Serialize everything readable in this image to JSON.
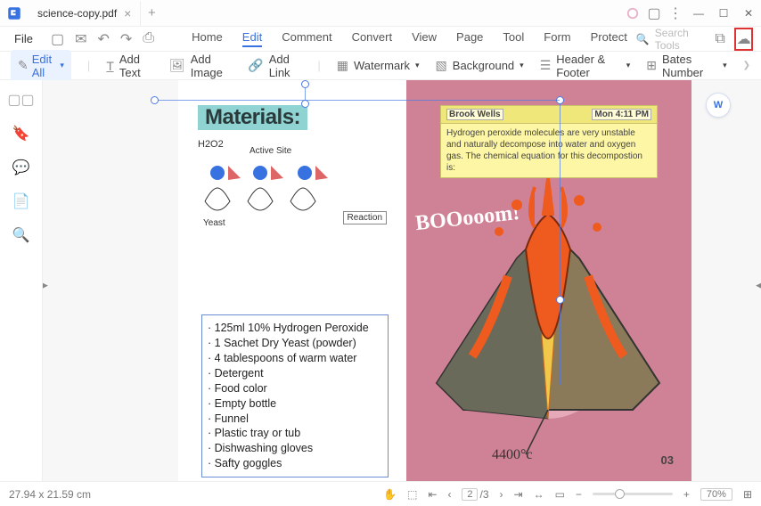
{
  "titlebar": {
    "doc_name": "science-copy.pdf"
  },
  "menu": {
    "file": "File",
    "ribbon": [
      "Home",
      "Edit",
      "Comment",
      "Convert",
      "View",
      "Page",
      "Tool",
      "Form",
      "Protect"
    ],
    "active_index": 1,
    "search_placeholder": "Search Tools"
  },
  "toolbar": {
    "edit_all": "Edit All",
    "add_text": "Add Text",
    "add_image": "Add Image",
    "add_link": "Add Link",
    "watermark": "Watermark",
    "background": "Background",
    "header_footer": "Header & Footer",
    "bates_number": "Bates Number"
  },
  "document": {
    "materials_title": "Materials:",
    "diagram": {
      "h2o2": "H2O2",
      "active_site": "Active Site",
      "yeast": "Yeast",
      "reaction": "Reaction"
    },
    "materials_list": [
      "125ml 10% Hydrogen Peroxide",
      "1 Sachet Dry Yeast (powder)",
      "4 tablespoons of warm water",
      "Detergent",
      "Food color",
      "Empty bottle",
      "Funnel",
      "Plastic tray or tub",
      "Dishwashing gloves",
      "Safty goggles"
    ],
    "comment": {
      "author": "Brook Wells",
      "time": "Mon 4:11 PM",
      "text": "Hydrogen peroxide molecules are very unstable and naturally decompose into water and oxygen gas. The chemical equation for this decompostion is:"
    },
    "boom": "BOOooom!",
    "temp": "4400°c",
    "page_num": "03"
  },
  "status": {
    "dimensions": "27.94 x 21.59 cm",
    "page_current": "2",
    "page_total": "/3",
    "zoom": "70%"
  }
}
